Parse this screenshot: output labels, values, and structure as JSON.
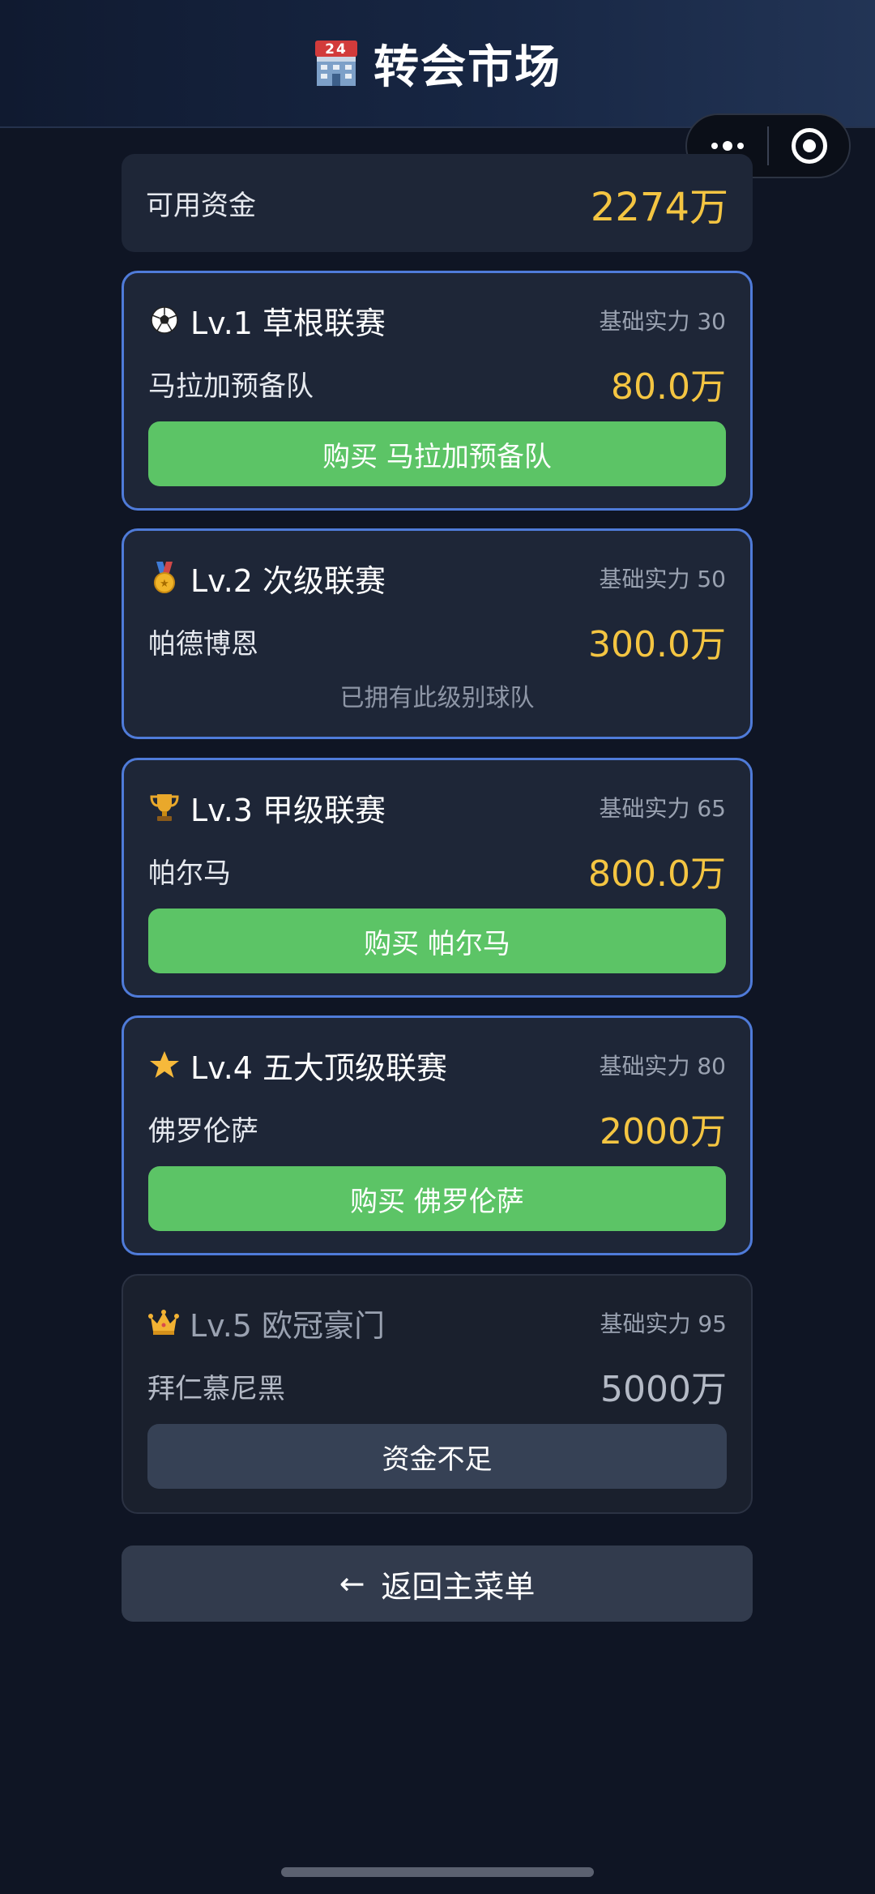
{
  "header": {
    "title": "转会市场",
    "icon": "hotel-24-icon"
  },
  "funds": {
    "label": "可用资金",
    "value": "2274万"
  },
  "tiers": [
    {
      "level": "Lv.1 草根联赛",
      "icon": "soccer-ball-icon",
      "strength": "基础实力 30",
      "team": "马拉加预备队",
      "price": "80.0万",
      "action": "购买 马拉加预备队",
      "state": "buy"
    },
    {
      "level": "Lv.2 次级联赛",
      "icon": "medal-icon",
      "strength": "基础实力 50",
      "team": "帕德博恩",
      "price": "300.0万",
      "note": "已拥有此级别球队",
      "state": "owned"
    },
    {
      "level": "Lv.3 甲级联赛",
      "icon": "trophy-icon",
      "strength": "基础实力 65",
      "team": "帕尔马",
      "price": "800.0万",
      "action": "购买 帕尔马",
      "state": "buy"
    },
    {
      "level": "Lv.4 五大顶级联赛",
      "icon": "star-icon",
      "strength": "基础实力 80",
      "team": "佛罗伦萨",
      "price": "2000万",
      "action": "购买 佛罗伦萨",
      "state": "buy"
    },
    {
      "level": "Lv.5 欧冠豪门",
      "icon": "crown-icon",
      "strength": "基础实力 95",
      "team": "拜仁慕尼黑",
      "price": "5000万",
      "action": "资金不足",
      "state": "insufficient"
    }
  ],
  "back_button": {
    "arrow": "←",
    "label": "返回主菜单"
  },
  "colors": {
    "accent_gold": "#f4c542",
    "buy_green": "#5cc466",
    "card_border": "#4f7bd9",
    "background": "#0f1524"
  }
}
